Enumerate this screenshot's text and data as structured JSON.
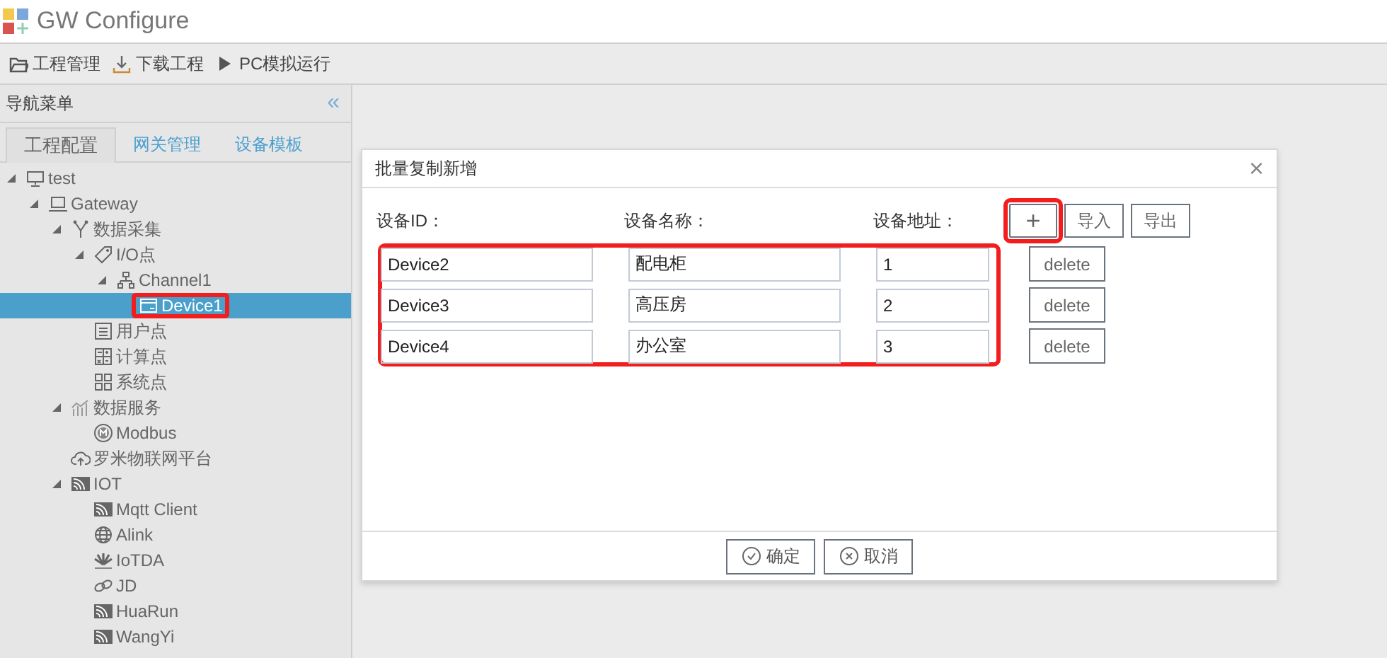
{
  "window": {
    "title": "GW Configure"
  },
  "toolbar": [
    {
      "kind": "folder",
      "label": "工程管理"
    },
    {
      "kind": "download",
      "label": "下载工程"
    },
    {
      "kind": "play",
      "label": "PC模拟运行"
    }
  ],
  "sidebar": {
    "title": "导航菜单",
    "collapse": "«",
    "tabs": [
      {
        "label": "工程配置",
        "selected": true
      },
      {
        "label": "网关管理",
        "selected": false
      },
      {
        "label": "设备模板",
        "selected": false
      }
    ],
    "tree": [
      {
        "label": "test",
        "kind": "monitor",
        "expanded": true,
        "selected": false,
        "annotated": false,
        "children": [
          {
            "label": "Gateway",
            "kind": "laptop",
            "expanded": true,
            "selected": false,
            "annotated": false,
            "children": [
              {
                "label": "数据采集",
                "kind": "branch",
                "expanded": true,
                "selected": false,
                "annotated": false,
                "children": [
                  {
                    "label": "I/O点",
                    "kind": "tag",
                    "expanded": true,
                    "selected": false,
                    "annotated": false,
                    "children": [
                      {
                        "label": "Channel1",
                        "kind": "network",
                        "expanded": true,
                        "selected": false,
                        "annotated": false,
                        "children": [
                          {
                            "label": "Device1",
                            "kind": "device",
                            "selected": true,
                            "annotated": true
                          }
                        ]
                      }
                    ]
                  },
                  {
                    "label": "用户点",
                    "kind": "list",
                    "selected": false,
                    "annotated": false
                  },
                  {
                    "label": "计算点",
                    "kind": "calc",
                    "selected": false,
                    "annotated": false
                  },
                  {
                    "label": "系统点",
                    "kind": "grid",
                    "selected": false,
                    "annotated": false
                  }
                ]
              },
              {
                "label": "数据服务",
                "kind": "chart",
                "expanded": true,
                "selected": false,
                "annotated": false,
                "children": [
                  {
                    "label": "Modbus",
                    "kind": "modbus",
                    "selected": false,
                    "annotated": false
                  }
                ]
              },
              {
                "label": "罗米物联网平台",
                "kind": "cloud",
                "selected": false,
                "annotated": false
              },
              {
                "label": "IOT",
                "kind": "signal",
                "expanded": true,
                "selected": false,
                "annotated": false,
                "children": [
                  {
                    "label": "Mqtt Client",
                    "kind": "signal",
                    "selected": false,
                    "annotated": false
                  },
                  {
                    "label": "Alink",
                    "kind": "globe",
                    "selected": false,
                    "annotated": false
                  },
                  {
                    "label": "IoTDA",
                    "kind": "petals",
                    "selected": false,
                    "annotated": false
                  },
                  {
                    "label": "JD",
                    "kind": "link",
                    "selected": false,
                    "annotated": false
                  },
                  {
                    "label": "HuaRun",
                    "kind": "signal",
                    "selected": false,
                    "annotated": false
                  },
                  {
                    "label": "WangYi",
                    "kind": "signal",
                    "selected": false,
                    "annotated": false
                  }
                ]
              }
            ]
          }
        ]
      }
    ]
  },
  "dialog": {
    "title": "批量复制新增",
    "close": "×",
    "columns": [
      "设备ID：",
      "设备名称：",
      "设备地址："
    ],
    "actions": [
      {
        "label": "+",
        "annotated": true
      },
      {
        "label": "导入",
        "annotated": false
      },
      {
        "label": "导出",
        "annotated": false
      }
    ],
    "rows_annotated": true,
    "rows": [
      {
        "id": "Device2",
        "name": "配电柜",
        "address": "1",
        "delete": "delete"
      },
      {
        "id": "Device3",
        "name": "高压房",
        "address": "2",
        "delete": "delete"
      },
      {
        "id": "Device4",
        "name": "办公室",
        "address": "3",
        "delete": "delete"
      }
    ],
    "footer": [
      {
        "kind": "ok",
        "label": "确定"
      },
      {
        "kind": "cancel",
        "label": "取消"
      }
    ]
  }
}
